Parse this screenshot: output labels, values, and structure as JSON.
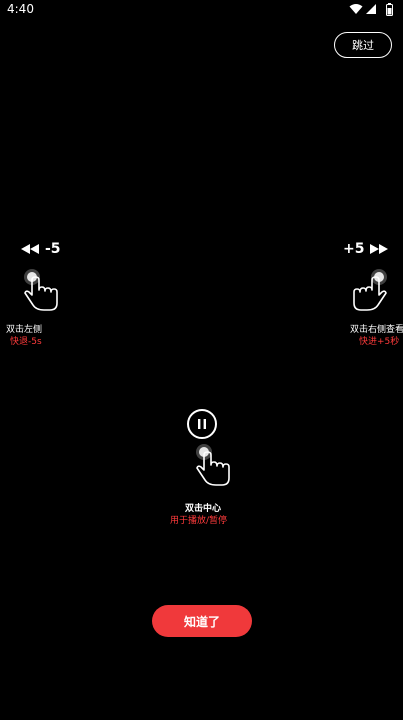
{
  "status_bar": {
    "time": "4:40"
  },
  "skip_label": "跳过",
  "left_gesture": {
    "step": "-5",
    "title": "双击左侧",
    "subtitle": "快退-5s"
  },
  "right_gesture": {
    "step": "+5",
    "title": "双击右侧查看",
    "subtitle": "快进+5秒"
  },
  "center_gesture": {
    "title": "双击中心",
    "subtitle": "用于播放/暂停"
  },
  "confirm_label": "知道了",
  "colors": {
    "accent": "#f0393b",
    "highlight_text": "#ff3b3b",
    "background": "#000000"
  },
  "icons": [
    "wifi-icon",
    "signal-icon",
    "battery-icon",
    "rewind-icon",
    "fast-forward-icon",
    "pause-icon",
    "tap-hand-icon"
  ]
}
